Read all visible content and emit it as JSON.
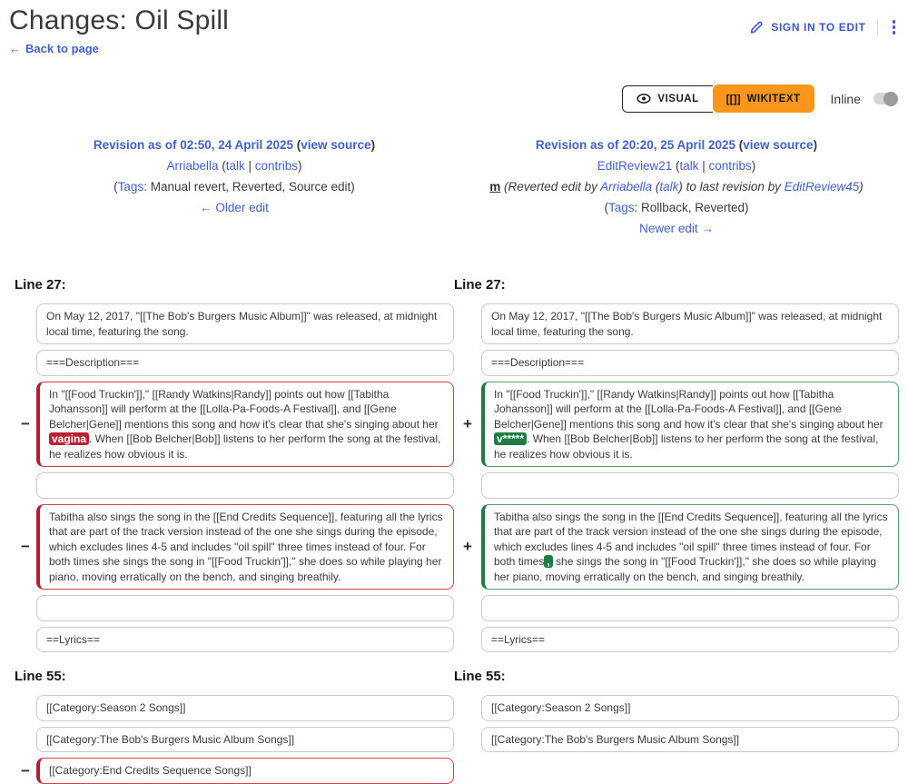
{
  "page": {
    "title": "Changes: Oil Spill",
    "back_arrow": "←",
    "back_label": "Back to page",
    "sign_in": "SIGN IN TO EDIT",
    "toolbar": {
      "visual": "VISUAL",
      "wikitext": "WIKITEXT",
      "wikitext_icon": "[[]]",
      "inline_label": "Inline"
    }
  },
  "colors": {
    "accent_orange": "#f8961d",
    "link_blue": "#415fc9",
    "removed_highlight": "#bc2133",
    "added_highlight": "#1e7c45",
    "removed_border": "#d0424e",
    "added_border": "#52a06e"
  },
  "markers": {
    "removed": "−",
    "added": "+"
  },
  "left_revision": {
    "lines": [
      {
        "bold": true,
        "segs": [
          {
            "t": "Revision as of 02:50, 24 April 2025",
            "link": true
          },
          {
            "t": " ("
          },
          {
            "t": "view source",
            "link": true
          },
          {
            "t": ")"
          }
        ]
      },
      {
        "segs": [
          {
            "t": "Arriabella",
            "link": true
          },
          {
            "t": " ("
          },
          {
            "t": "talk",
            "link": true
          },
          {
            "t": " | "
          },
          {
            "t": "contribs",
            "link": true
          },
          {
            "t": ")"
          }
        ]
      },
      {
        "segs": [
          {
            "t": "("
          },
          {
            "t": "Tags",
            "link": true
          },
          {
            "t": ": Manual revert, Reverted, Source edit)"
          }
        ]
      },
      {
        "segs": [
          {
            "t": "← Older edit",
            "link": true
          }
        ]
      }
    ]
  },
  "right_revision": {
    "lines": [
      {
        "bold": true,
        "segs": [
          {
            "t": "Revision as of 20:20, 25 April 2025",
            "link": true
          },
          {
            "t": " ("
          },
          {
            "t": "view source",
            "link": true
          },
          {
            "t": ")"
          }
        ]
      },
      {
        "segs": [
          {
            "t": "EditReview21",
            "link": true
          },
          {
            "t": " ("
          },
          {
            "t": "talk",
            "link": true
          },
          {
            "t": " | "
          },
          {
            "t": "contribs",
            "link": true
          },
          {
            "t": ")"
          }
        ]
      },
      {
        "segs": [
          {
            "t": "m",
            "minor": true
          },
          {
            "t": " "
          },
          {
            "t": "(Reverted edit by ",
            "em": true
          },
          {
            "t": "Arriabella",
            "link": true,
            "em": true
          },
          {
            "t": " (",
            "em": true
          },
          {
            "t": "talk",
            "link": true,
            "em": true
          },
          {
            "t": ") to last revision by ",
            "em": true
          },
          {
            "t": "EditReview45",
            "link": true,
            "em": true
          },
          {
            "t": ")",
            "em": true
          }
        ]
      },
      {
        "segs": [
          {
            "t": "("
          },
          {
            "t": "Tags",
            "link": true
          },
          {
            "t": ": Rollback, Reverted)"
          }
        ]
      },
      {
        "segs": [
          {
            "t": "Newer edit →",
            "link": true
          }
        ]
      }
    ]
  },
  "diff": {
    "sections": [
      {
        "header": "Line 27:",
        "rows": [
          {
            "kind": "same",
            "left": [
              {
                "t": "On May 12, 2017, \"[[The Bob's Burgers Music Album]]\" was released, at midnight local time, featuring the song."
              }
            ],
            "right": [
              {
                "t": "On May 12, 2017, \"[[The Bob's Burgers Music Album]]\" was released, at midnight local time, featuring the song."
              }
            ]
          },
          {
            "kind": "same",
            "left": [
              {
                "t": "===Description==="
              }
            ],
            "right": [
              {
                "t": "===Description==="
              }
            ]
          },
          {
            "kind": "change",
            "left": [
              {
                "t": "In \"[[Food Truckin']],\" [[Randy Watkins|Randy]] points out how [[Tabitha Johansson]] will perform at the [[Lolla-Pa-Foods-A Festival]], and [[Gene Belcher|Gene]] mentions this song and how it's clear that she's singing about her "
              },
              {
                "t": "vagina",
                "m": "del"
              },
              {
                "t": ". When [[Bob Belcher|Bob]] listens to her perform the song at the festival, he realizes how obvious it is."
              }
            ],
            "right": [
              {
                "t": "In \"[[Food Truckin']],\" [[Randy Watkins|Randy]] points out how [[Tabitha Johansson]] will perform at the [[Lolla-Pa-Foods-A Festival]], and [[Gene Belcher|Gene]] mentions this song and how it's clear that she's singing about her "
              },
              {
                "t": "v*****",
                "m": "ins"
              },
              {
                "t": ". When [[Bob Belcher|Bob]] listens to her perform the song at the festival, he realizes how obvious it is."
              }
            ]
          },
          {
            "kind": "same",
            "left": [],
            "right": []
          },
          {
            "kind": "change",
            "left": [
              {
                "t": "Tabitha also sings the song in the [[End Credits Sequence]], featuring all the lyrics that are part of the track version instead of the one she sings during the episode, which excludes lines 4-5 and includes \"oil spill\" three times instead of four. For both times she sings the song in \"[[Food Truckin']],\" she does so while playing her piano, moving erratically on the bench, and singing breathily."
              }
            ],
            "right": [
              {
                "t": "Tabitha also sings the song in the [[End Credits Sequence]], featuring all the lyrics that are part of the track version instead of the one she sings during the episode, which excludes lines 4-5 and includes \"oil spill\" three times instead of four. For both times"
              },
              {
                "t": ",",
                "m": "ins"
              },
              {
                "t": " she sings the song in \"[[Food Truckin']],\" she does so while playing her piano, moving erratically on the bench, and singing breathily."
              }
            ]
          },
          {
            "kind": "same",
            "left": [],
            "right": []
          },
          {
            "kind": "same",
            "left": [
              {
                "t": "==Lyrics=="
              }
            ],
            "right": [
              {
                "t": "==Lyrics=="
              }
            ]
          }
        ]
      },
      {
        "header": "Line 55:",
        "rows": [
          {
            "kind": "same",
            "left": [
              {
                "t": "[[Category:Season 2 Songs]]"
              }
            ],
            "right": [
              {
                "t": "[[Category:Season 2 Songs]]"
              }
            ]
          },
          {
            "kind": "same",
            "left": [
              {
                "t": "[[Category:The Bob's Burgers Music Album Songs]]"
              }
            ],
            "right": [
              {
                "t": "[[Category:The Bob's Burgers Music Album Songs]]"
              }
            ]
          },
          {
            "kind": "del-only",
            "left": [
              {
                "t": "[[Category:End Credits Sequence Songs]]"
              }
            ],
            "right": null
          }
        ]
      }
    ]
  }
}
